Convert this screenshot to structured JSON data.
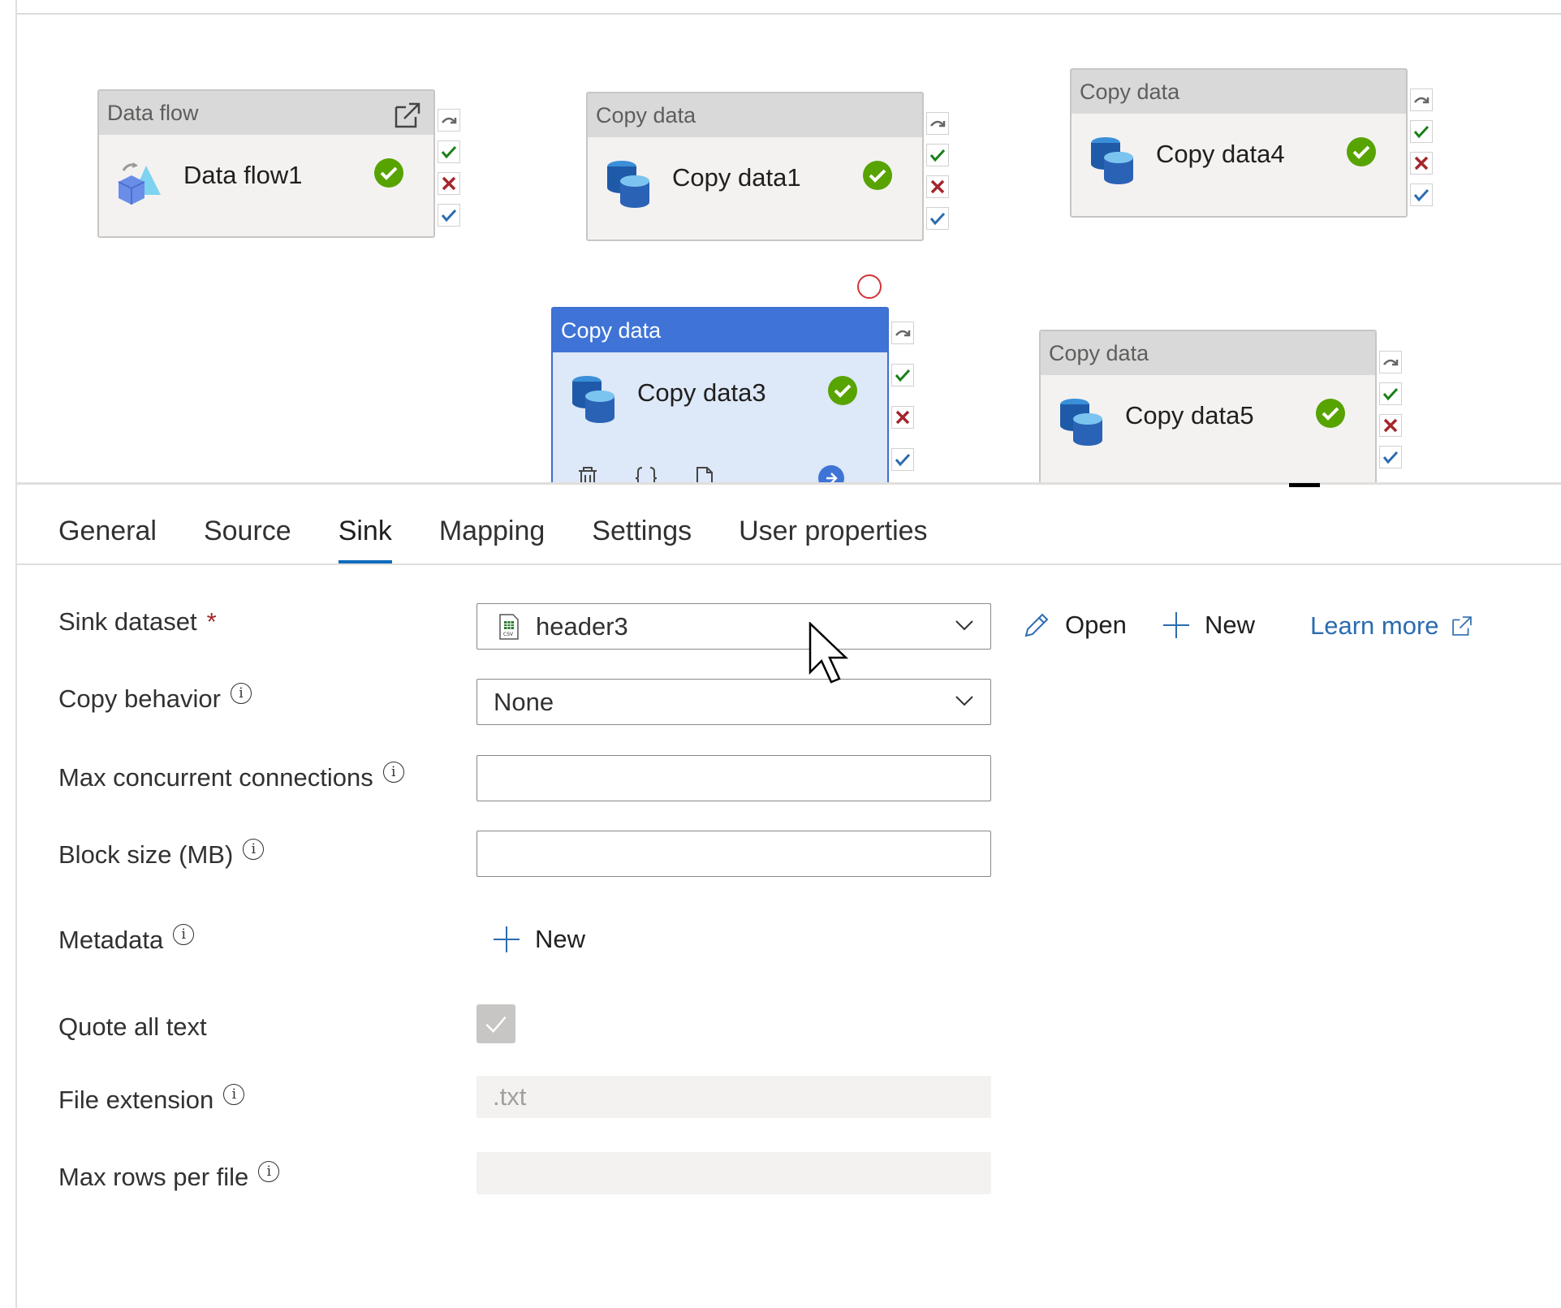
{
  "canvas": {
    "activities": [
      {
        "id": "df1",
        "type_label": "Data flow",
        "name": "Data flow1"
      },
      {
        "id": "cd1",
        "type_label": "Copy data",
        "name": "Copy data1"
      },
      {
        "id": "cd4",
        "type_label": "Copy data",
        "name": "Copy data4"
      },
      {
        "id": "cd3",
        "type_label": "Copy data",
        "name": "Copy data3",
        "selected": true
      },
      {
        "id": "cd5",
        "type_label": "Copy data",
        "name": "Copy data5"
      }
    ]
  },
  "tabs": [
    {
      "label": "General"
    },
    {
      "label": "Source"
    },
    {
      "label": "Sink",
      "active": true
    },
    {
      "label": "Mapping"
    },
    {
      "label": "Settings"
    },
    {
      "label": "User properties"
    }
  ],
  "form": {
    "sink_dataset": {
      "label": "Sink dataset",
      "required_mark": "*",
      "value": "header3"
    },
    "open_label": "Open",
    "new_label": "New",
    "learn_more_label": "Learn more",
    "copy_behavior": {
      "label": "Copy behavior",
      "value": "None"
    },
    "max_concurrent": {
      "label": "Max concurrent connections",
      "value": ""
    },
    "block_size": {
      "label": "Block size (MB)",
      "value": ""
    },
    "metadata": {
      "label": "Metadata",
      "new_label": "New"
    },
    "quote_all_text": {
      "label": "Quote all text",
      "checked": true
    },
    "file_extension": {
      "label": "File extension",
      "value": ".txt"
    },
    "max_rows": {
      "label": "Max rows per file",
      "value": ""
    }
  },
  "colors": {
    "accent": "#0f6cbd",
    "success": "#57a300",
    "fail": "#a4262c",
    "selected_header": "#3f74d6"
  }
}
